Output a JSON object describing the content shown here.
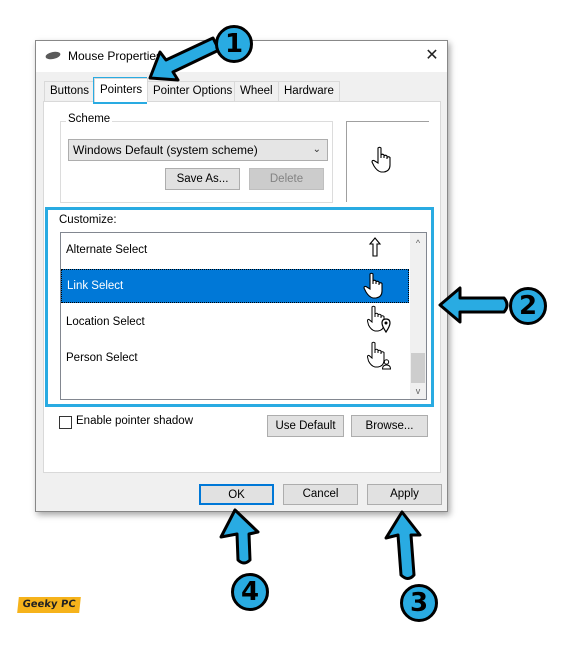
{
  "window": {
    "title": "Mouse Properties",
    "icon": "mouse-icon",
    "close_label": "✕"
  },
  "tabs": [
    {
      "label": "Buttons",
      "active": false
    },
    {
      "label": "Pointers",
      "active": true
    },
    {
      "label": "Pointer Options",
      "active": false
    },
    {
      "label": "Wheel",
      "active": false
    },
    {
      "label": "Hardware",
      "active": false
    }
  ],
  "scheme": {
    "group_label": "Scheme",
    "selected": "Windows Default (system scheme)",
    "save_as_label": "Save As...",
    "delete_label": "Delete"
  },
  "customize": {
    "label": "Customize:",
    "items": [
      {
        "label": "Alternate Select",
        "cursor": "up-arrow-icon",
        "selected": false
      },
      {
        "label": "Link Select",
        "cursor": "hand-pointer-icon",
        "selected": true
      },
      {
        "label": "Location Select",
        "cursor": "hand-location-icon",
        "selected": false
      },
      {
        "label": "Person Select",
        "cursor": "hand-person-icon",
        "selected": false
      }
    ],
    "scroll_up": "^",
    "scroll_down": "v"
  },
  "shadow": {
    "label": "Enable pointer shadow",
    "checked": false
  },
  "buttons": {
    "use_default": "Use Default",
    "browse": "Browse...",
    "ok": "OK",
    "cancel": "Cancel",
    "apply": "Apply"
  },
  "callouts": [
    "1",
    "2",
    "3",
    "4"
  ],
  "accent_colors": {
    "highlight": "#29abe2",
    "selection": "#0078d7"
  },
  "watermark": "Geeky PC"
}
